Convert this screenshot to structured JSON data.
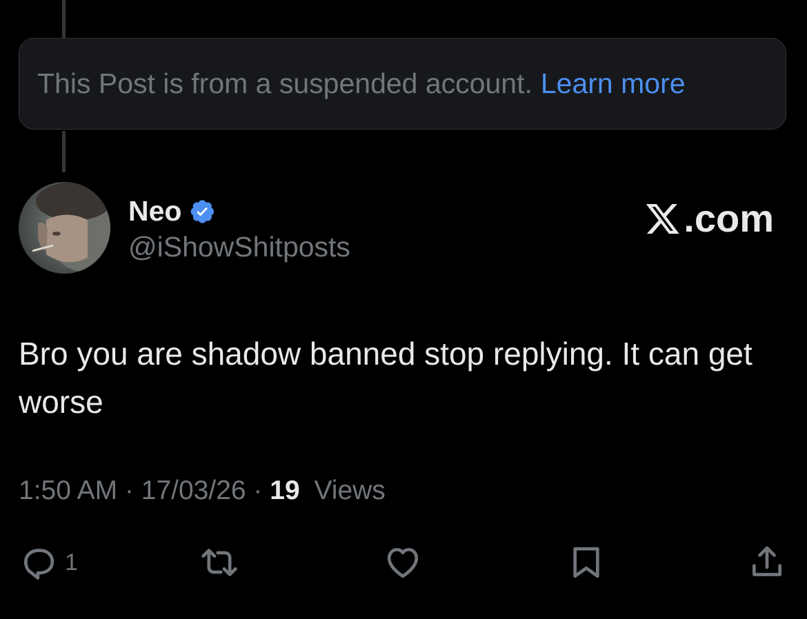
{
  "suspended_notice": {
    "text": "This Post is from a suspended account.",
    "link": "Learn more"
  },
  "author": {
    "name": "Neo",
    "handle": "@iShowShitposts",
    "verified": true
  },
  "watermark": ".com",
  "post": {
    "text": "Bro you are shadow banned stop replying. It can get worse"
  },
  "meta": {
    "time": "1:50 AM",
    "date": "17/03/26",
    "views_count": "19",
    "views_label": "Views"
  },
  "actions": {
    "reply_count": "1"
  },
  "icons": [
    "reply-icon",
    "repost-icon",
    "like-icon",
    "bookmark-icon",
    "share-icon",
    "verified-badge-icon",
    "x-logo-icon"
  ],
  "colors": {
    "background": "#000000",
    "link": "#4d8ff0",
    "secondary_text": "#71767b",
    "primary_text": "#e7e9ea",
    "verified": "#4d8ff0"
  }
}
